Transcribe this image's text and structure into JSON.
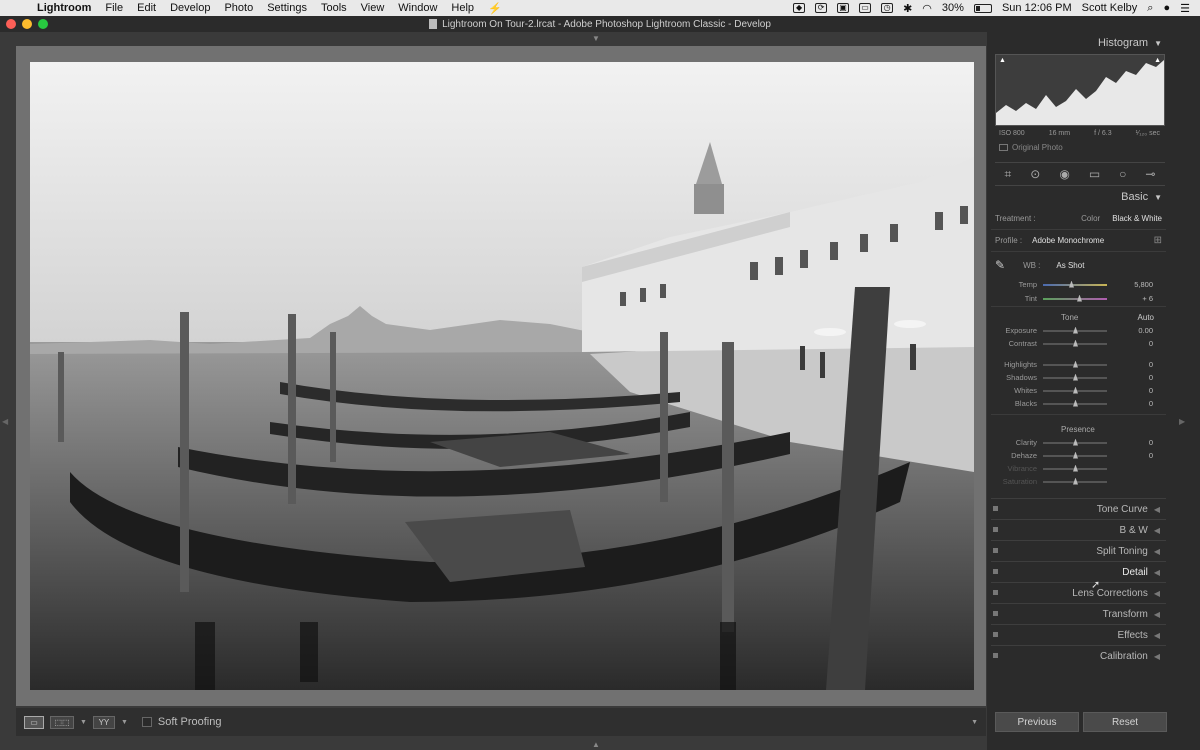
{
  "menubar": {
    "app": "Lightroom",
    "items": [
      "File",
      "Edit",
      "Develop",
      "Photo",
      "Settings",
      "Tools",
      "View",
      "Window",
      "Help"
    ],
    "battery": "30%",
    "battery_level": 0.3,
    "clock": "Sun 12:06 PM",
    "user": "Scott Kelby"
  },
  "window": {
    "title": "Lightroom On Tour-2.lrcat - Adobe Photoshop Lightroom Classic - Develop",
    "traffic_colors": [
      "#fc5f57",
      "#fdbc2e",
      "#28c840"
    ]
  },
  "toolbar": {
    "soft_proofing": "Soft Proofing",
    "compare_label": "YY"
  },
  "histogram": {
    "title": "Histogram",
    "iso": "ISO 800",
    "focal": "16 mm",
    "aperture": "f / 6.3",
    "shutter": "¹⁄₁₂₀ sec",
    "original_photo": "Original Photo"
  },
  "basic": {
    "title": "Basic",
    "treatment_label": "Treatment :",
    "treatment_color": "Color",
    "treatment_bw": "Black & White",
    "profile_label": "Profile :",
    "profile_value": "Adobe Monochrome",
    "wb_label": "WB :",
    "wb_value": "As Shot",
    "temp_label": "Temp",
    "temp_value": "5,800",
    "tint_label": "Tint",
    "tint_value": "+ 6",
    "tone_label": "Tone",
    "auto_label": "Auto",
    "tone_sliders": [
      {
        "label": "Exposure",
        "value": "0.00"
      },
      {
        "label": "Contrast",
        "value": "0"
      },
      {
        "label": "Highlights",
        "value": "0"
      },
      {
        "label": "Shadows",
        "value": "0"
      },
      {
        "label": "Whites",
        "value": "0"
      },
      {
        "label": "Blacks",
        "value": "0"
      }
    ],
    "presence_label": "Presence",
    "presence_sliders": [
      {
        "label": "Clarity",
        "value": "0"
      },
      {
        "label": "Dehaze",
        "value": "0"
      },
      {
        "label": "Vibrance",
        "value": ""
      },
      {
        "label": "Saturation",
        "value": ""
      }
    ]
  },
  "panels": [
    "Tone Curve",
    "B & W",
    "Split Toning",
    "Detail",
    "Lens Corrections",
    "Transform",
    "Effects",
    "Calibration"
  ],
  "buttons": {
    "previous": "Previous",
    "reset": "Reset"
  },
  "colors": {
    "panel_bg": "#2b2b2b",
    "canvas_bg": "#717171",
    "accent_temp": "#c8b454",
    "accent_tint": "#b05cb0"
  }
}
